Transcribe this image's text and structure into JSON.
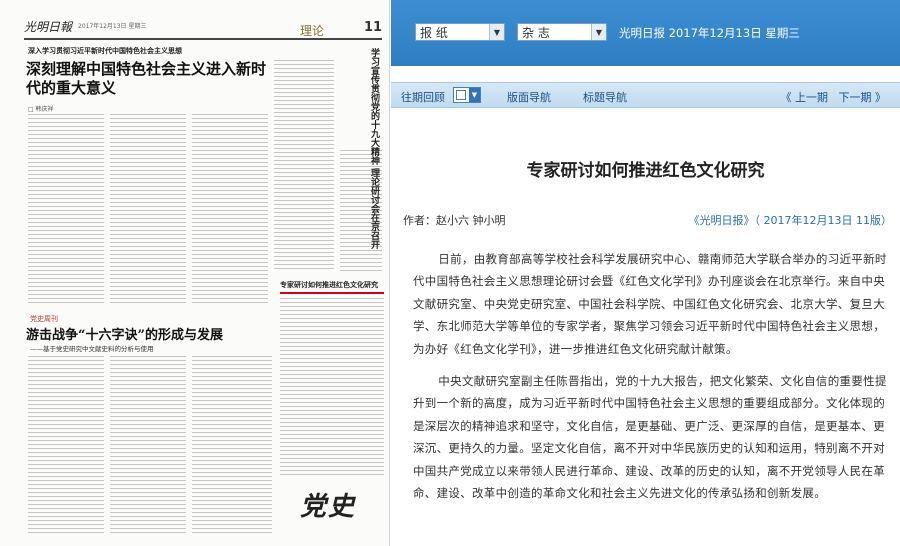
{
  "paper": {
    "masthead": "光明日報",
    "date_line": "2017年12月13日 星期三",
    "section": "理论",
    "page_no": "11",
    "kicker": "深入学习贯彻习近平新时代中国特色社会主义思想",
    "headline": "深刻理解中国特色社会主义进入新时代的重大意义",
    "author": "□ 韩庆祥",
    "vertical_title": "学习宣传贯彻党的十九大精神 理论研讨会在京召开",
    "highlight_title": "专家研讨如何推进红色文化研究",
    "tag2": "党史周刊",
    "headline2": "游击战争“十六字诀”的形成与发展",
    "subhead2": "——基于党史研究中文献史料的分析与使用",
    "logo": "党史"
  },
  "toolbar": {
    "paper_select": "报 纸",
    "type_select": "杂 志",
    "info": "光明日报  2017年12月13日  星期三"
  },
  "nav": {
    "date_label": "往期回顾",
    "directory_label": "版面导航",
    "title_nav_label": "标题导航",
    "prev_label": "上一期",
    "next_label": "下一期"
  },
  "article": {
    "title": "专家研讨如何推进红色文化研究",
    "byline": "作者：赵小六  钟小明",
    "source": "《光明日报》（ 2017年12月13日 11版）",
    "paragraphs": [
      "日前，由教育部高等学校社会科学发展研究中心、赣南师范大学联合举办的习近平新时代中国特色社会主义思想理论研讨会暨《红色文化学刊》办刊座谈会在北京举行。来自中央文献研究室、中央党史研究室、中国社会科学院、中国红色文化研究会、北京大学、复旦大学、东北师范大学等单位的专家学者，聚焦学习领会习近平新时代中国特色社会主义思想，为办好《红色文化学刊》，进一步推进红色文化研究献计献策。",
      "中央文献研究室副主任陈晋指出，党的十九大报告，把文化繁荣、文化自信的重要性提升到一个新的高度，成为习近平新时代中国特色社会主义思想的重要组成部分。文化体现的是深层次的精神追求和坚守，文化自信，是更基础、更广泛、更深厚的自信，是更基本、更深沉、更持久的力量。坚定文化自信，离不开对中华民族历史的认知和运用，特别离不开对中国共产党成立以来带领人民进行革命、建设、改革的历史的认知，离不开党领导人民在革命、建设、改革中创造的革命文化和社会主义先进文化的传承弘扬和创新发展。"
    ]
  }
}
